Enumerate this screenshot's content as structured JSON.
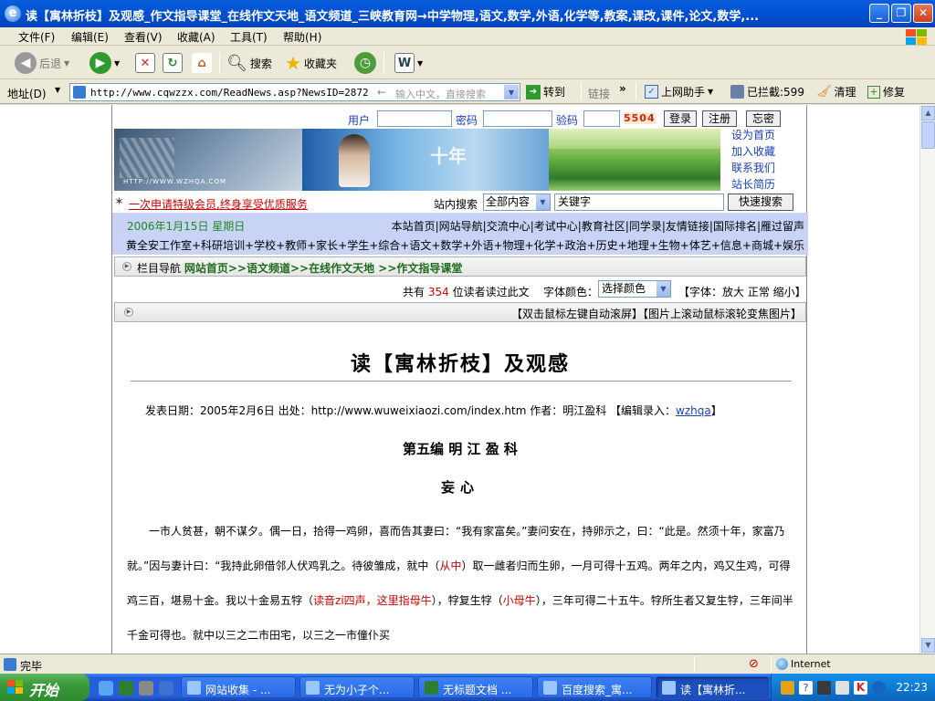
{
  "window": {
    "title": "读【寓林折枝】及观感_作文指导课堂_在线作文天地_语文频道_三峡教育网→中学物理,语文,数学,外语,化学等,教案,课改,课件,论文,数学,...",
    "minimize": "_",
    "maximize": "❐",
    "close": "✕"
  },
  "menu": [
    "文件(F)",
    "编辑(E)",
    "查看(V)",
    "收藏(A)",
    "工具(T)",
    "帮助(H)"
  ],
  "toolbar": {
    "back": "后退",
    "search": "搜索",
    "favorites": "收藏夹"
  },
  "addressbar": {
    "label": "地址(D)",
    "url": "http://www.cqwzzx.com/ReadNews.asp?NewsID=2872",
    "hint": "输入中文，直接搜索",
    "go": "转到",
    "links": "链接",
    "helper": "上网助手",
    "blocked": "已拦截:599",
    "clean": "清理",
    "repair": "修复"
  },
  "site": {
    "login": {
      "user_label": "用户",
      "pass_label": "密码",
      "code_label": "验码",
      "captcha": "5504",
      "login_btn": "登录",
      "register_btn": "注册",
      "forgot_btn": "忘密"
    },
    "banner_url": "HTTP://WWW.WZHQA.COM",
    "banner_text": "十年",
    "side_links": [
      "设为首页",
      "加入收藏",
      "联系我们",
      "站长简历"
    ],
    "promo": "一次申请特级会员,终身享受优质服务",
    "search": {
      "label": "站内搜索",
      "scope": "全部内容",
      "keyword": "关键字",
      "button": "快速搜索"
    },
    "date": "2006年1月15日 星期日",
    "nav1": "本站首页|网站导航|交流中心|考试中心|教育社区|同学录|友情链接|国际排名|雁过留声",
    "nav2": "黄全安工作室+科研培训+学校+教师+家长+学生+综合+语文+数学+外语+物理+化学+政治+历史+地理+生物+体艺+信息+商城+娱乐",
    "crumb": {
      "prefix": "栏目导航",
      "home": "网站首页",
      "sep1": ">>",
      "c1": "语文频道",
      "sep2": ">>",
      "c2": "在线作文天地",
      "sep3": " >>",
      "c3": "作文指导课堂"
    },
    "info": {
      "readers_pre": "共有",
      "readers_num": "354",
      "readers_post": "位读者读过此文",
      "color_label": "字体颜色：",
      "color_select": "选择颜色",
      "font_size": "【字体：放大 正常 缩小】"
    },
    "scroll_hint": "【双击鼠标左键自动滚屏】【图片上滚动鼠标滚轮变焦图片】"
  },
  "article": {
    "title": "读【寓林折枝】及观感",
    "meta_pre": "发表日期：2005年2月6日   出处：http://www.wuweixiaozi.com/index.htm   作者：明江盈科     【编辑录入：",
    "editor": "wzhqa",
    "meta_post": "】",
    "chapter": "第五编 明  江 盈 科",
    "section": "妄心",
    "p1_a": "一市人贫甚，朝不谋夕。偶一日，拾得一鸡卵，喜而告其妻曰：“我有家富矣。”妻问安在，持卵示之，曰：“此是。然须十年，家富乃就。”因与妻计曰：“我持此卵借邻人伏鸡乳之。待彼雏成，就中（",
    "p1_r1": "从中",
    "p1_b": "）取一雌者归而生卵，一月可得十五鸡。两年之内，鸡又生鸡，可得鸡三百，堪易十金。我以十金易五牸（",
    "p1_r2": "读音zi四声，这里指母牛",
    "p1_c": "），牸复生牸（",
    "p1_r3": "小母牛",
    "p1_d": "），三年可得二十五牛。牸所生者又复生牸，三年间半千金可得也。就中以三之二市田宅，以三之一市僮仆买"
  },
  "statusbar": {
    "text": "完毕",
    "zone": "Internet"
  },
  "taskbar": {
    "start": "开始",
    "tasks": [
      "网站收集 - ...",
      "无为小子个...",
      "无标题文档 ...",
      "百度搜索_寓...",
      "读【寓林折..."
    ],
    "time": "22:23"
  }
}
